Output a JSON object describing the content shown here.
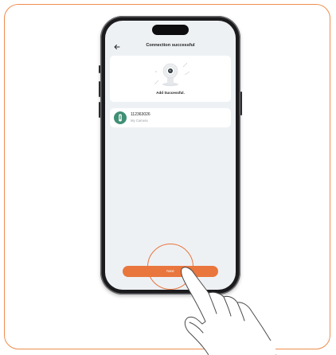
{
  "screen": {
    "title": "Connection successful",
    "back_icon": "arrow-left-icon",
    "success_message": "Add Successful.",
    "device": {
      "id": "112363026",
      "name": "My Camera",
      "icon": "camera-device-icon"
    },
    "next_button_label": "Next"
  },
  "colors": {
    "accent": "#e9763d",
    "frame_border": "#ef8d4f",
    "screen_background": "#eef1f4",
    "device_badge": "#3f8f74"
  }
}
